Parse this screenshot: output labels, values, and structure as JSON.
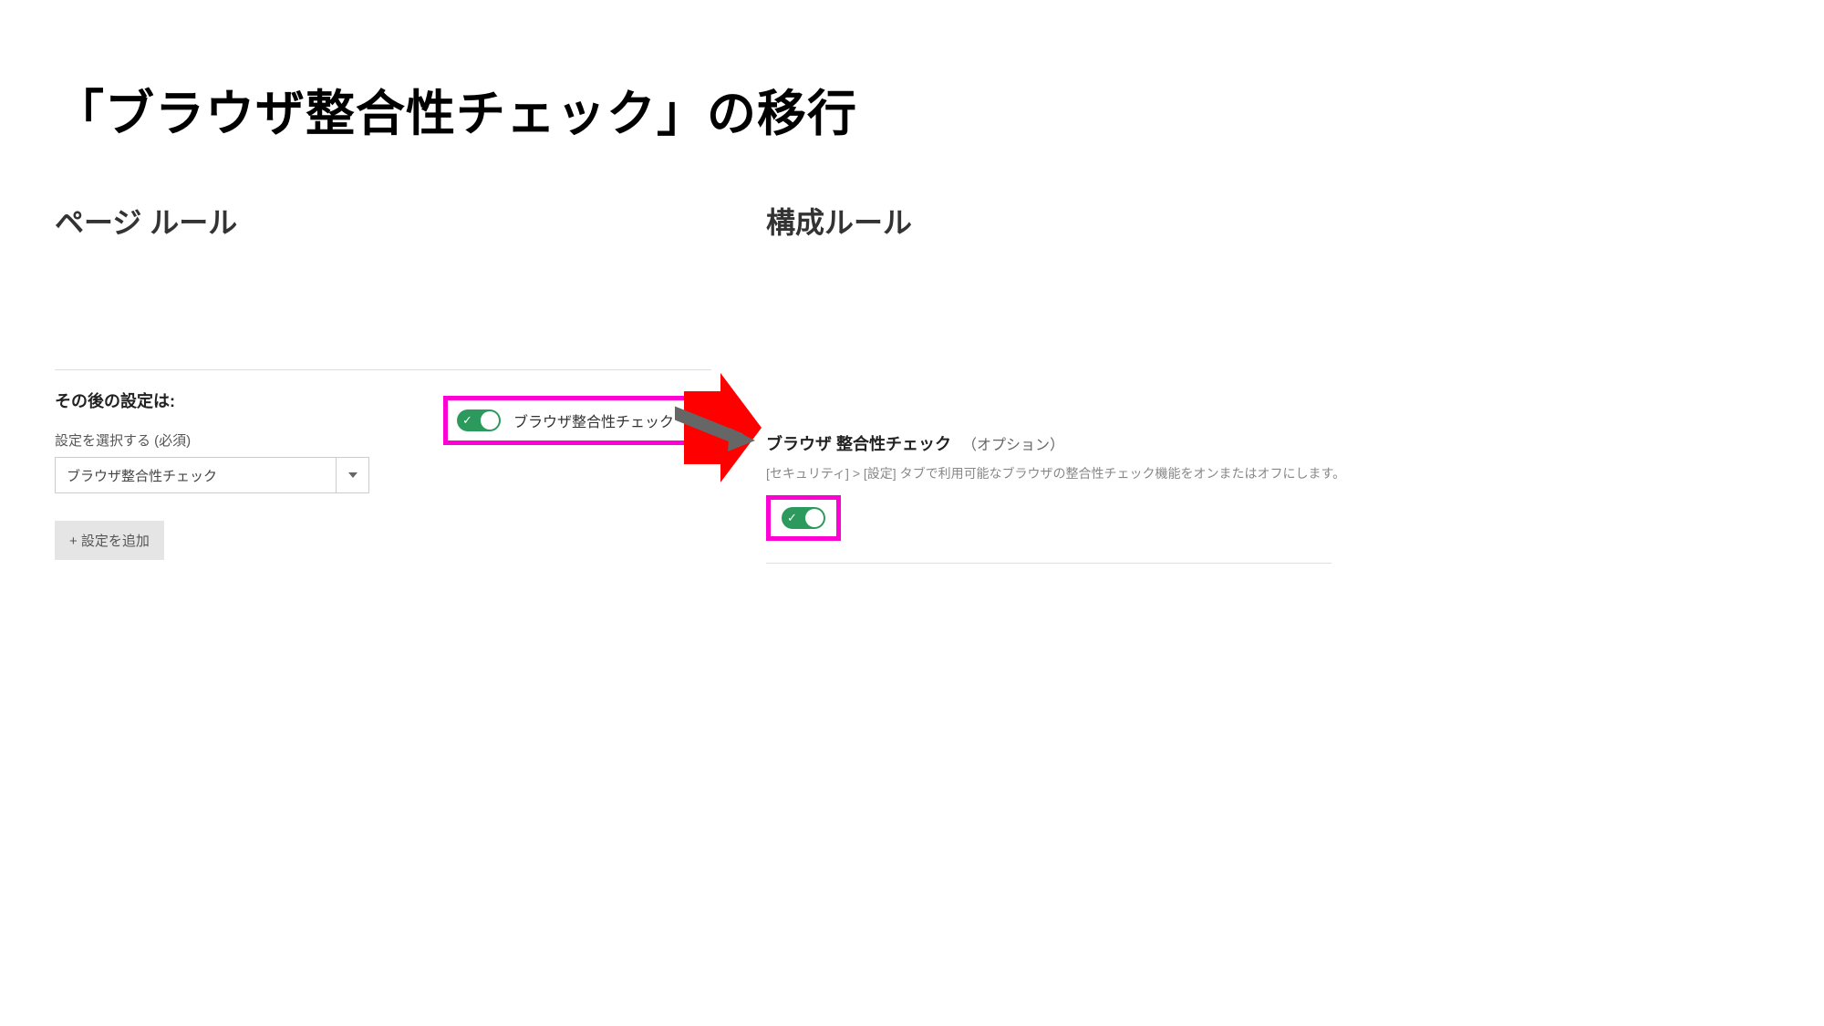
{
  "title": "「ブラウザ整合性チェック」の移行",
  "left": {
    "heading": "ページ ルール",
    "sub_heading": "その後の設定は:",
    "field_label": "設定を選択する (必須)",
    "select_value": "ブラウザ整合性チェック",
    "add_button": "+ 設定を追加",
    "toggle_label": "ブラウザ整合性チェック"
  },
  "right": {
    "heading": "構成ルール",
    "title": "ブラウザ 整合性チェック",
    "option": "（オプション）",
    "description": "[セキュリティ] > [設定] タブで利用可能なブラウザの整合性チェック機能をオンまたはオフにします。"
  }
}
